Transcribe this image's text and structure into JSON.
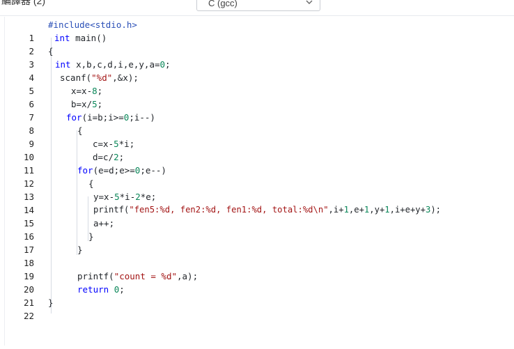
{
  "header": {
    "compiler_label": "編譯器 (2)",
    "language_value": "C (gcc)"
  },
  "code": {
    "lines": [
      {
        "n": "1"
      },
      {
        "n": "2"
      },
      {
        "n": "3"
      },
      {
        "n": "4"
      },
      {
        "n": "5"
      },
      {
        "n": "6"
      },
      {
        "n": "7"
      },
      {
        "n": "8"
      },
      {
        "n": "9"
      },
      {
        "n": "10"
      },
      {
        "n": "11"
      },
      {
        "n": "12"
      },
      {
        "n": "13"
      },
      {
        "n": "14"
      },
      {
        "n": "15"
      },
      {
        "n": "16"
      },
      {
        "n": "17"
      },
      {
        "n": "18"
      },
      {
        "n": "19"
      },
      {
        "n": "20"
      },
      {
        "n": "21"
      },
      {
        "n": "22"
      }
    ],
    "tokens": {
      "l1": "#include<stdio.h>",
      "l2a": "int",
      "l2b": " main()",
      "l3": "{",
      "l4a": "int",
      "l4b": " x,b,c,d,i,e,y,a=",
      "l4c": "0",
      "l4d": ";",
      "l5a": "scanf(",
      "l5b": "\"%d\"",
      "l5c": ",&x);",
      "l6a": "x=x-",
      "l6b": "8",
      "l6c": ";",
      "l7a": "b=x/",
      "l7b": "5",
      "l7c": ";",
      "l8a": "for",
      "l8b": "(i=b;i>=",
      "l8c": "0",
      "l8d": ";i--)",
      "l9": "{",
      "l10a": "c=x-",
      "l10b": "5",
      "l10c": "*i;",
      "l11a": "d=c/",
      "l11b": "2",
      "l11c": ";",
      "l12a": "for",
      "l12b": "(e=d;e>=",
      "l12c": "0",
      "l12d": ";e--)",
      "l13": "{",
      "l14a": "y=x-",
      "l14b": "5",
      "l14c": "*i-",
      "l14d": "2",
      "l14e": "*e;",
      "l15a": "printf(",
      "l15b": "\"fen5:%d, fen2:%d, fen1:%d, total:%d\\n\"",
      "l15c": ",i+",
      "l15d": "1",
      "l15e": ",e+",
      "l15f": "1",
      "l15g": ",y+",
      "l15h": "1",
      "l15i": ",i+e+y+",
      "l15j": "3",
      "l15k": ");",
      "l16": "a++;",
      "l17": "}",
      "l18": "}",
      "l19": "",
      "l20a": "printf(",
      "l20b": "\"count = %d\"",
      "l20c": ",a);",
      "l21a": "return",
      "l21b": " ",
      "l21c": "0",
      "l21d": ";",
      "l22": "}"
    }
  }
}
